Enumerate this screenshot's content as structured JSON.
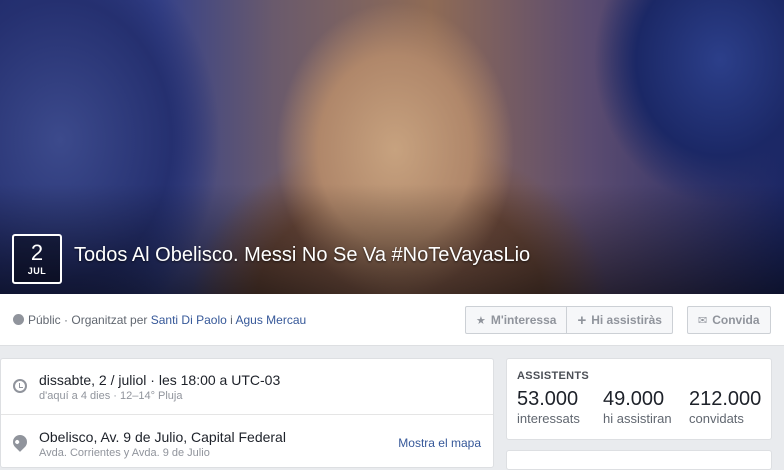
{
  "event": {
    "date_day": "2",
    "date_month": "JUL",
    "title": "Todos Al Obelisco. Messi No Se Va #NoTeVayasLio"
  },
  "meta": {
    "privacy": "Públic",
    "organized_by_prefix": "· Organitzat per",
    "organizer_1": "Santi Di Paolo",
    "conjunction": "i",
    "organizer_2": "Agus Mercau"
  },
  "actions": {
    "interested_label": "M'interessa",
    "going_label": "Hi assistiràs",
    "invite_label": "Convida"
  },
  "details": {
    "datetime_main": "dissabte, 2 / juliol · les 18:00 a UTC-03",
    "datetime_sub": "d'aquí a 4 dies · 12–14° Pluja",
    "location_main": "Obelisco, Av. 9 de Julio, Capital Federal",
    "location_sub": "Avda. Corrientes y Avda. 9 de Julio",
    "map_link": "Mostra el mapa"
  },
  "attendees": {
    "heading": "ASSISTENTS",
    "stats": [
      {
        "value": "53.000",
        "label": "interessats"
      },
      {
        "value": "49.000",
        "label": "hi assistiran"
      },
      {
        "value": "212.000",
        "label": "convidats"
      }
    ]
  },
  "icons": {
    "star": "★",
    "plus": "+",
    "envelope": "✉"
  }
}
